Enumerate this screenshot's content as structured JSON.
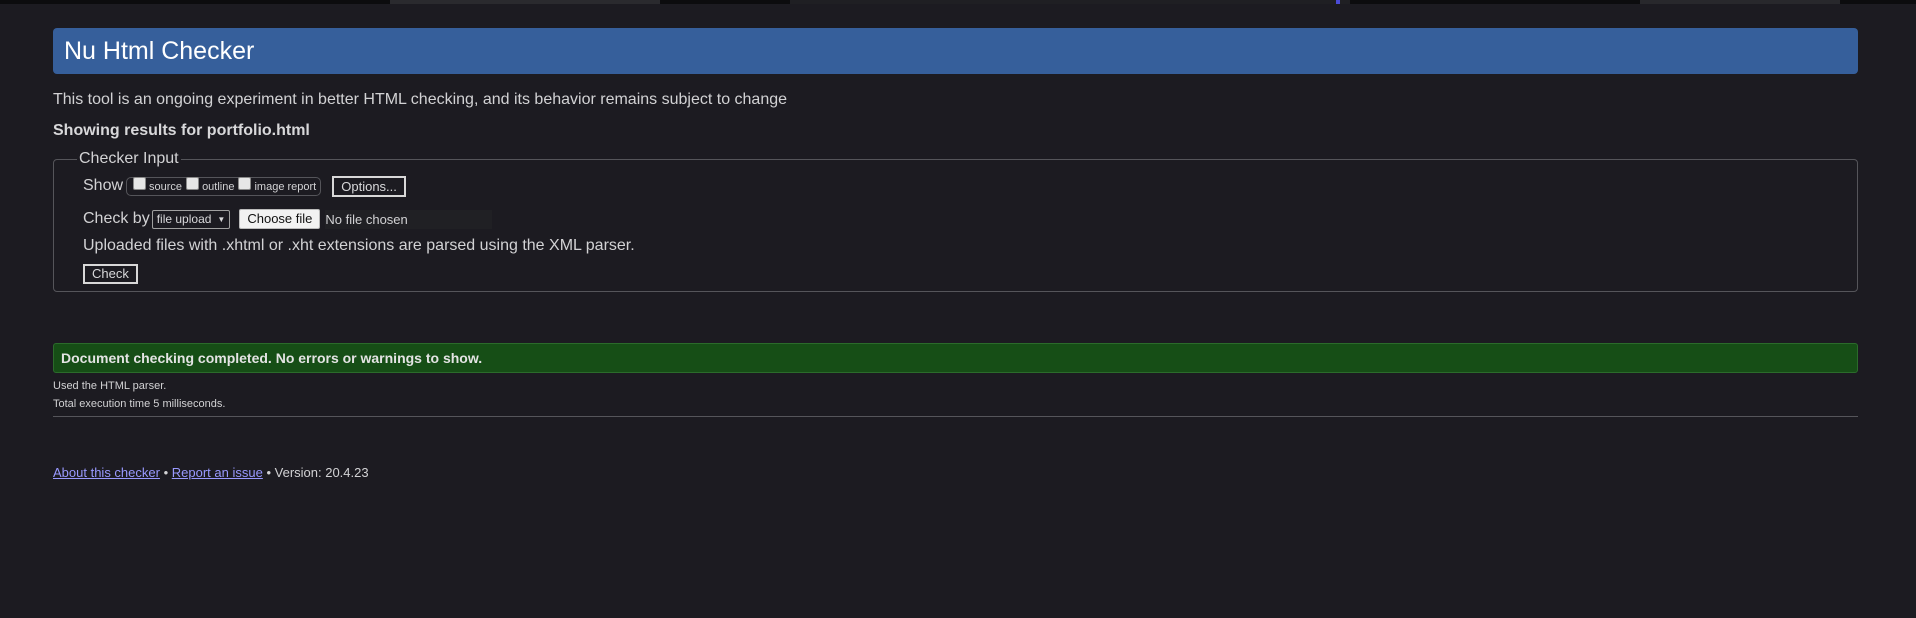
{
  "header": {
    "title": "Nu Html Checker"
  },
  "intro": "This tool is an ongoing experiment in better HTML checking, and its behavior remains subject to change",
  "results_for": "Showing results for portfolio.html",
  "checker_input": {
    "legend": "Checker Input",
    "show_label": "Show",
    "show_options": [
      {
        "label": "source",
        "checked": false
      },
      {
        "label": "outline",
        "checked": false
      },
      {
        "label": "image report",
        "checked": false
      }
    ],
    "options_button": "Options...",
    "check_by_label": "Check by",
    "check_by_selected": "file upload",
    "choose_file_button": "Choose file",
    "file_status": "No file chosen",
    "xml_note": "Uploaded files with .xhtml or .xht extensions are parsed using the XML parser.",
    "check_button": "Check"
  },
  "result": {
    "message": "Document checking completed. No errors or warnings to show.",
    "parser": "Used the HTML parser.",
    "execution_time": "Total execution time 5 milliseconds."
  },
  "footer": {
    "about_link": "About this checker",
    "separator": "•",
    "report_link": "Report an issue",
    "version": "Version: 20.4.23"
  },
  "colors": {
    "background": "#1c1b21",
    "title_bar": "#365f9b",
    "success": "#164e16",
    "link": "#9999ff"
  }
}
